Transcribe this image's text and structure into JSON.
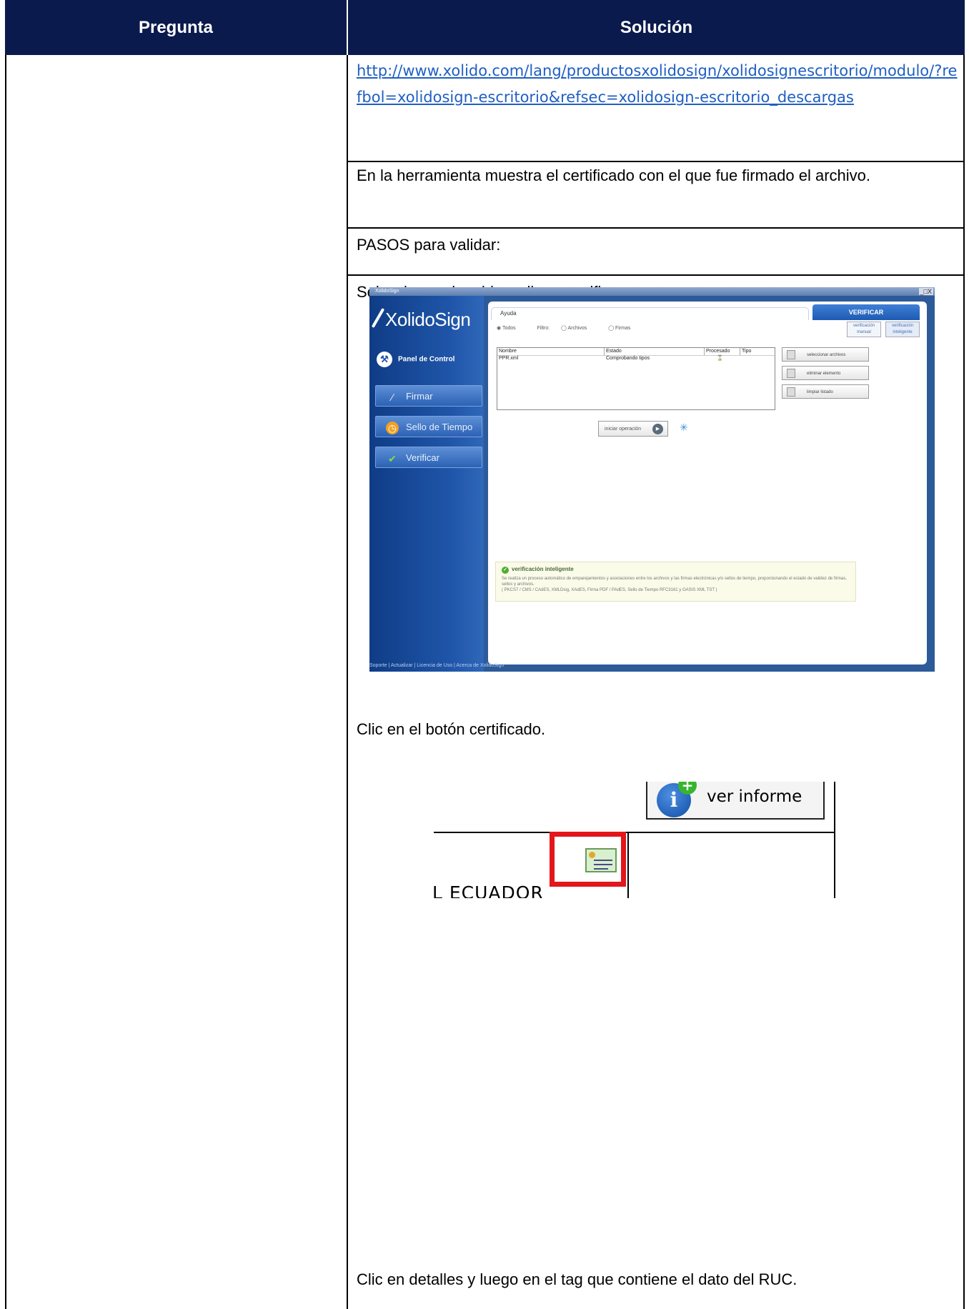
{
  "table": {
    "headers": {
      "pregunta": "Pregunta",
      "solucion": "Solución"
    }
  },
  "rows": {
    "link": "http://www.xolido.com/lang/productosxolidosign/xolidosignescritorio/modulo/?refbol=xolidosign-escritorio&refsec=xolidosign-escritorio_descargas",
    "certificado_text": "En la herramienta muestra el certificado con el que fue firmado el archivo.",
    "pasos": "PASOS para validar:",
    "step1": "Seleccionar el archivo, clic en verificar.",
    "step2": "Clic en el botón certificado.",
    "step3": "Clic en detalles y luego en el tag que contiene el dato del RUC."
  },
  "xolidosign": {
    "window_title": "XolidoSign",
    "window_controls": "_□X",
    "logo": "XolidoSign",
    "panel": "Panel de Control",
    "nav": {
      "firmar": "Firmar",
      "sello": "Sello de Tiempo",
      "verificar": "Verificar"
    },
    "tab": "Ayuda",
    "verificar_header": "VERIFICAR",
    "radios": {
      "todos": "Todos",
      "filtro": "Filtro:",
      "archivos": "Archivos",
      "firmas": "Firmas"
    },
    "modes": {
      "manual": "verificación manual",
      "inteligente": "verificación inteligente"
    },
    "grid_headers": {
      "nombre": "Nombre",
      "estado": "Estado",
      "procesado": "Procesado",
      "tipo": "Tipo"
    },
    "grid_row": {
      "nombre": "PPR.xml",
      "estado": "Comprobando tipos"
    },
    "actions": {
      "seleccionar": "seleccionar archivos",
      "eliminar": "eliminar elemento",
      "limpiar": "limpiar listado"
    },
    "start": "iniciar operación",
    "info_title": "verificación inteligente",
    "info_text": "Se realiza un proceso automático de emparejamientos y asociaciones entre los archivos y las firmas electrónicas y/o sellos de tiempo, proporcionando el estado de validez de firmas, sellos y archivos.",
    "info_formats": "( PKCS7 / CMS / CAdES, XMLDsig, XAdES, Firma PDF / PAdES, Sello de Tiempo RFC3161 y OASIS XML TST )",
    "footer": "Soporte  |  Actualizar  |  Licencia de Uso  |  Acerca de XolidoSign"
  },
  "informe": {
    "button": "ver informe",
    "info_glyph": "i",
    "plus_glyph": "+",
    "partial_text": "L ECUADOR"
  },
  "colors": {
    "header_bg": "#0b1a4d",
    "link": "#1f5fc2",
    "highlight": "#e3161b"
  }
}
